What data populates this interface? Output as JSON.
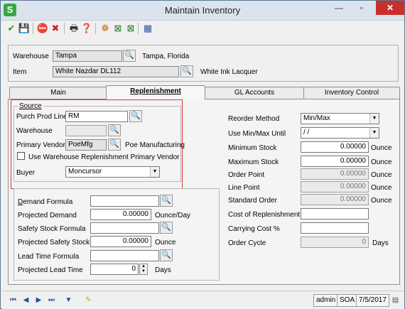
{
  "window": {
    "title": "Maintain Inventory",
    "app_icon": "S",
    "minimize": "—",
    "maximize": "▫",
    "close": "✕"
  },
  "toolbar": [
    {
      "name": "accept-icon",
      "glyph": "✔",
      "color": "#2c9a2c"
    },
    {
      "name": "save-icon",
      "glyph": "💾",
      "color": "#2a5aa5"
    },
    {
      "name": "cancel-icon",
      "glyph": "⛔",
      "color": "#cc2222"
    },
    {
      "name": "delete-icon",
      "glyph": "✖",
      "color": "#cc2222"
    },
    {
      "name": "print-icon",
      "glyph": "🖶",
      "color": "#333"
    },
    {
      "name": "help-icon",
      "glyph": "❓",
      "color": "#2a5aa5"
    },
    {
      "name": "color-wheel-icon",
      "glyph": "❁",
      "color": "#d07020"
    },
    {
      "name": "export-icon",
      "glyph": "⊠",
      "color": "#2a7a2a"
    },
    {
      "name": "import-icon",
      "glyph": "⊠",
      "color": "#2a7a2a"
    },
    {
      "name": "calculator-icon",
      "glyph": "▦",
      "color": "#2a5aa5"
    }
  ],
  "header": {
    "warehouse_label": "Warehouse",
    "warehouse_value": "Tampa",
    "warehouse_desc": "Tampa, Florida",
    "item_label": "Item",
    "item_value": "White Nazdar DL112",
    "item_desc": "White Ink Lacquer"
  },
  "tabs": [
    {
      "label": "Main",
      "active": false
    },
    {
      "label": "Replenishment",
      "active": true
    },
    {
      "label": "GL Accounts",
      "active": false
    },
    {
      "label": "Inventory Control",
      "active": false
    }
  ],
  "source": {
    "group_label": "Source",
    "purch_prod_line_label": "Purch Prod Line",
    "purch_prod_line_value": "RM",
    "warehouse_label": "Warehouse",
    "warehouse_value": "",
    "primary_vendor_label": "Primary Vendor",
    "primary_vendor_value": "PoeMfg",
    "primary_vendor_desc": "Poe Manufacturing",
    "use_wh_label": "Use Warehouse Replenishment Primary Vendor",
    "use_wh_checked": false,
    "buyer_label": "Buyer",
    "buyer_value": "Moncursor"
  },
  "formulas": {
    "demand_formula_label": "Demand Formula",
    "demand_formula_value": "",
    "projected_demand_label": "Projected Demand",
    "projected_demand_value": "0.00000",
    "projected_demand_unit": "Ounce/Day",
    "safety_stock_formula_label": "Safety Stock Formula",
    "safety_stock_formula_value": "",
    "projected_safety_stock_label": "Projected Safety Stock",
    "projected_safety_stock_value": "0.00000",
    "projected_safety_stock_unit": "Ounce",
    "lead_time_formula_label": "Lead Time Formula",
    "lead_time_formula_value": "",
    "projected_lead_time_label": "Projected Lead Time",
    "projected_lead_time_value": "0",
    "projected_lead_time_unit": "Days"
  },
  "reorder": {
    "reorder_method_label": "Reorder Method",
    "reorder_method_value": "Min/Max",
    "use_min_max_until_label": "Use Min/Max Until",
    "use_min_max_until_value": " / /",
    "minimum_stock_label": "Minimum Stock",
    "minimum_stock_value": "0.00000",
    "minimum_stock_unit": "Ounce",
    "maximum_stock_label": "Maximum Stock",
    "maximum_stock_value": "0.00000",
    "maximum_stock_unit": "Ounce",
    "order_point_label": "Order Point",
    "order_point_value": "0.00000",
    "order_point_unit": "Ounce",
    "line_point_label": "Line Point",
    "line_point_value": "0.00000",
    "line_point_unit": "Ounce",
    "standard_order_label": "Standard Order",
    "standard_order_value": "0.00000",
    "standard_order_unit": "Ounce",
    "cost_of_replenishment_label": "Cost of Replenishment",
    "cost_of_replenishment_value": "",
    "carrying_cost_label": "Carrying Cost %",
    "carrying_cost_value": "",
    "order_cycle_label": "Order Cycle",
    "order_cycle_value": "0",
    "order_cycle_unit": "Days"
  },
  "status": {
    "user": "admin",
    "company": "SOA",
    "date": "7/5/2017"
  }
}
